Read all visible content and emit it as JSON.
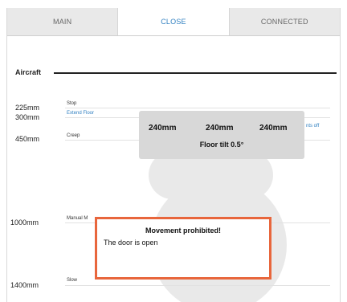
{
  "tabs": [
    {
      "label": "MAIN"
    },
    {
      "label": "CLOSE"
    },
    {
      "label": "CONNECTED"
    }
  ],
  "active_tab": "CLOSE",
  "aircraft_label": "Aircraft",
  "levels": [
    {
      "distance": "225mm",
      "note": "Stop"
    },
    {
      "distance": "300mm",
      "note": "Extend Floor"
    },
    {
      "distance": "450mm",
      "note": "Creep"
    },
    {
      "distance": "1000mm",
      "note": "Manual M"
    },
    {
      "distance": "1400mm",
      "note": "Slow"
    }
  ],
  "floor_panel": {
    "left": "240mm",
    "center": "240mm",
    "right": "240mm",
    "tilt": "Floor tilt 0.5°",
    "partial_note": "nts off"
  },
  "dialog": {
    "title": "Movement prohibited!",
    "message": "The door is open"
  },
  "colors": {
    "accent": "#2f7fc0",
    "alert_border": "#e8663c"
  }
}
